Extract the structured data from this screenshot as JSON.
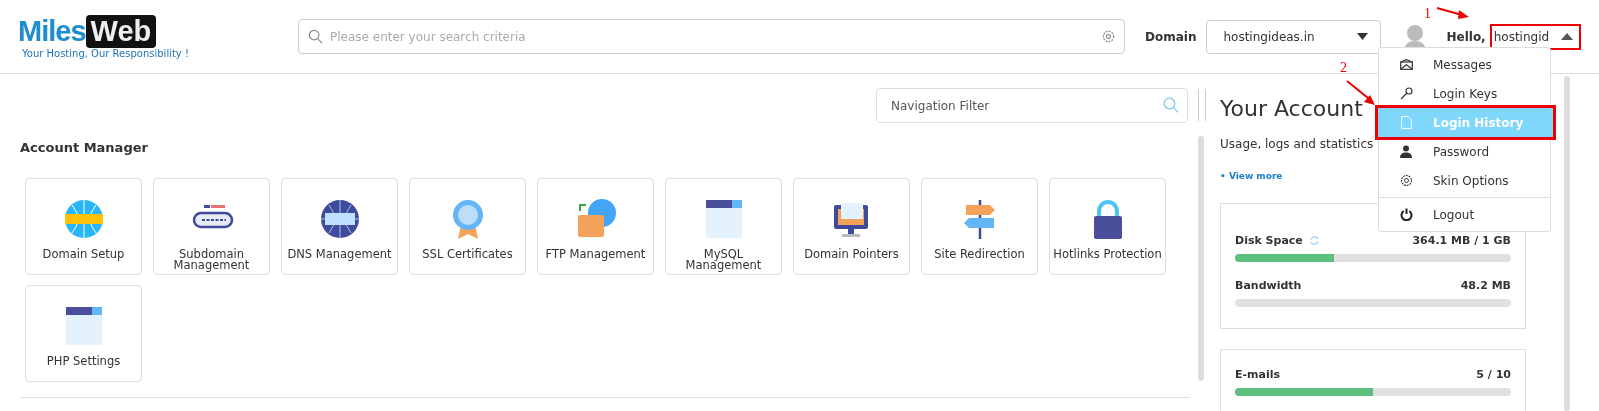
{
  "logo": {
    "word_1": "Miles",
    "word_2": "Web",
    "tagline": "Your Hosting, Our Responsibility !"
  },
  "search": {
    "placeholder": "Please enter your search criteria"
  },
  "domain": {
    "label": "Domain",
    "value": "hostingideas.in"
  },
  "user": {
    "greeting": "Hello,",
    "name": "hostingid",
    "menu_open": true
  },
  "user_menu": [
    {
      "label": "Messages",
      "selected": false
    },
    {
      "label": "Login Keys",
      "selected": false
    },
    {
      "label": "Login History",
      "selected": true
    },
    {
      "label": "Password",
      "selected": false
    },
    {
      "label": "Skin Options",
      "selected": false
    },
    {
      "label": "Logout",
      "selected": false
    }
  ],
  "annotations": [
    "1",
    "2"
  ],
  "navigation_filter": {
    "placeholder": "Navigation Filter"
  },
  "account_manager": {
    "title": "Account Manager",
    "tiles": [
      "Domain Setup",
      "Subdomain Management",
      "DNS Management",
      "SSL Certificates",
      "FTP Management",
      "MySQL Management",
      "Domain Pointers",
      "Site Redirection",
      "Hotlinks Protection",
      "PHP Settings"
    ]
  },
  "your_account": {
    "title": "Your Account",
    "subtitle": "Usage, logs and statistics",
    "link": "• View more",
    "cards": [
      [
        {
          "name": "Disk Space",
          "reading": "364.1 MB / 1 GB",
          "level": 0.36,
          "refresh": true
        },
        {
          "name": "Bandwidth",
          "reading": "48.2 MB",
          "refresh": false
        }
      ],
      [
        {
          "name": "E-mails",
          "reading": "5 / 10",
          "level": 0.5,
          "refresh": false
        }
      ]
    ]
  }
}
